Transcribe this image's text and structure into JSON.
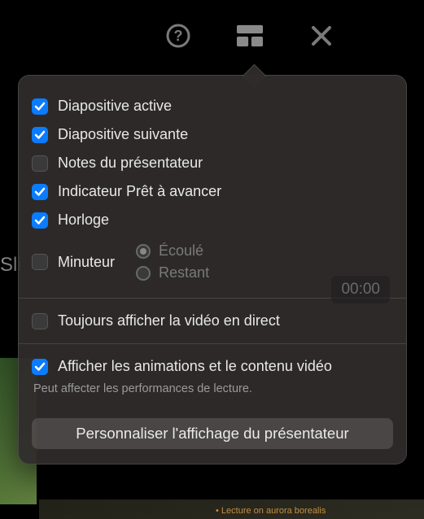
{
  "bg": {
    "truncated_text": "Sli",
    "caption": "• Lecture on aurora borealis"
  },
  "checkrows": {
    "active_slide": {
      "label": "Diapositive active",
      "checked": true
    },
    "next_slide": {
      "label": "Diapositive suivante",
      "checked": true
    },
    "presenter_notes": {
      "label": "Notes du présentateur",
      "checked": false
    },
    "ready_indicator": {
      "label": "Indicateur Prêt à avancer",
      "checked": true
    },
    "clock": {
      "label": "Horloge",
      "checked": true
    },
    "timer": {
      "label": "Minuteur",
      "checked": false
    },
    "live_video": {
      "label": "Toujours afficher la vidéo en direct",
      "checked": false
    },
    "show_animations": {
      "label": "Afficher les animations et le contenu vidéo",
      "checked": true
    }
  },
  "timer_radios": {
    "elapsed": {
      "label": "Écoulé",
      "selected": true
    },
    "remaining": {
      "label": "Restant",
      "selected": false
    }
  },
  "time_value": "00:00",
  "hint": "Peut affecter les performances de lecture.",
  "footer_button": "Personnaliser l'affichage du présentateur"
}
